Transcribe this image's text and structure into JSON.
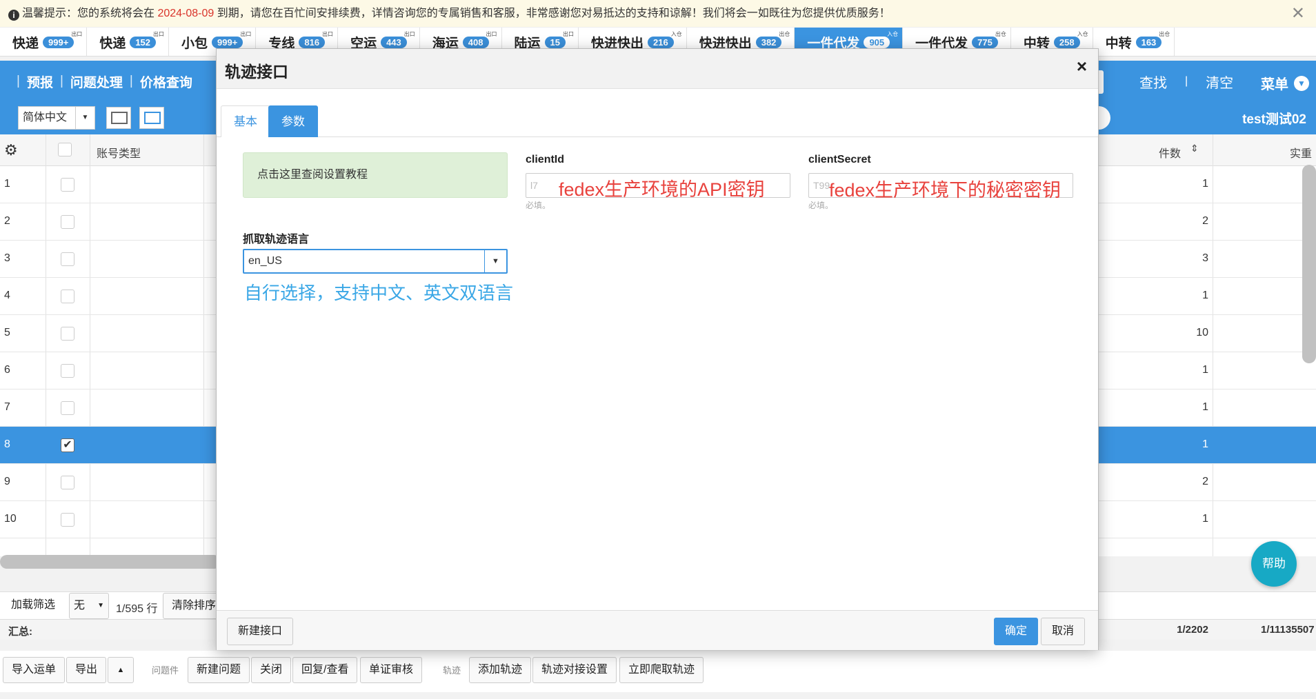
{
  "notice": {
    "prefix": "温馨提示：您的系统将会在 ",
    "date": "2024-08-09",
    "suffix": " 到期，请您在百忙间安排续费，详情咨询您的专属销售和客服，非常感谢您对易抵达的支持和谅解！我们将会一如既往为您提供优质服务！",
    "close": "✕"
  },
  "tabs": [
    {
      "label": "快递",
      "count": "999+",
      "sup": "出口"
    },
    {
      "label": "快递",
      "count": "152",
      "sup": "出口"
    },
    {
      "label": "小包",
      "count": "999+",
      "sup": "出口"
    },
    {
      "label": "专线",
      "count": "816",
      "sup": "出口"
    },
    {
      "label": "空运",
      "count": "443",
      "sup": "出口"
    },
    {
      "label": "海运",
      "count": "408",
      "sup": "出口"
    },
    {
      "label": "陆运",
      "count": "15",
      "sup": "出口"
    },
    {
      "label": "快进快出",
      "count": "216",
      "sup": "入仓"
    },
    {
      "label": "快进快出",
      "count": "382",
      "sup": "出仓"
    },
    {
      "label": "一件代发",
      "count": "905",
      "sup": "入仓"
    },
    {
      "label": "一件代发",
      "count": "775",
      "sup": "出仓"
    },
    {
      "label": "中转",
      "count": "258",
      "sup": "入仓"
    },
    {
      "label": "中转",
      "count": "163",
      "sup": "出仓"
    }
  ],
  "nav": {
    "links": [
      "预报",
      "问题处理",
      "价格查询"
    ],
    "find": "查找",
    "clear": "清空",
    "menu": "菜单",
    "lang": "简体中文",
    "user": "test测试02"
  },
  "grid": {
    "headers": {
      "account_type": "账号类型",
      "count": "件数",
      "weight": "实重"
    },
    "rows": [
      {
        "num": "1",
        "count": "1"
      },
      {
        "num": "2",
        "count": "2"
      },
      {
        "num": "3",
        "count": "3"
      },
      {
        "num": "4",
        "count": "1"
      },
      {
        "num": "5",
        "count": "10"
      },
      {
        "num": "6",
        "count": "1"
      },
      {
        "num": "7",
        "count": "1"
      },
      {
        "num": "8",
        "count": "1"
      },
      {
        "num": "9",
        "count": "2"
      },
      {
        "num": "10",
        "count": "1"
      }
    ]
  },
  "footer": {
    "load_filter": "加载筛选",
    "none": "无",
    "rows": "1/595 行",
    "clear_sort": "清除排序",
    "sum_label": "汇总:",
    "sum_count": "1/2202",
    "sum_weight": "1/11135507"
  },
  "bottom": {
    "import": "导入运单",
    "export": "导出",
    "issues_label": "问题件",
    "new_issue": "新建问题",
    "close": "关闭",
    "reply": "回复/查看",
    "audit": "单证审核",
    "track_label": "轨迹",
    "add_track": "添加轨迹",
    "track_settings": "轨迹对接设置",
    "crawl": "立即爬取轨迹"
  },
  "help": "帮助",
  "modal": {
    "title": "轨迹接口",
    "close": "×",
    "tabs": {
      "basic": "基本",
      "params": "参数"
    },
    "tutorial": "点击这里查阅设置教程",
    "client_id_label": "clientId",
    "client_secret_label": "clientSecret",
    "client_id_value": "l7",
    "client_secret_value": "T99",
    "required_hint": "必填。",
    "anno_client_id": "fedex生产环境的API密钥",
    "anno_client_secret": "fedex生产环境下的秘密密钥",
    "lang_label": "抓取轨迹语言",
    "lang_value": "en_US",
    "anno_lang": "自行选择，支持中文、英文双语言",
    "new_interface": "新建接口",
    "ok": "确定",
    "cancel": "取消"
  }
}
